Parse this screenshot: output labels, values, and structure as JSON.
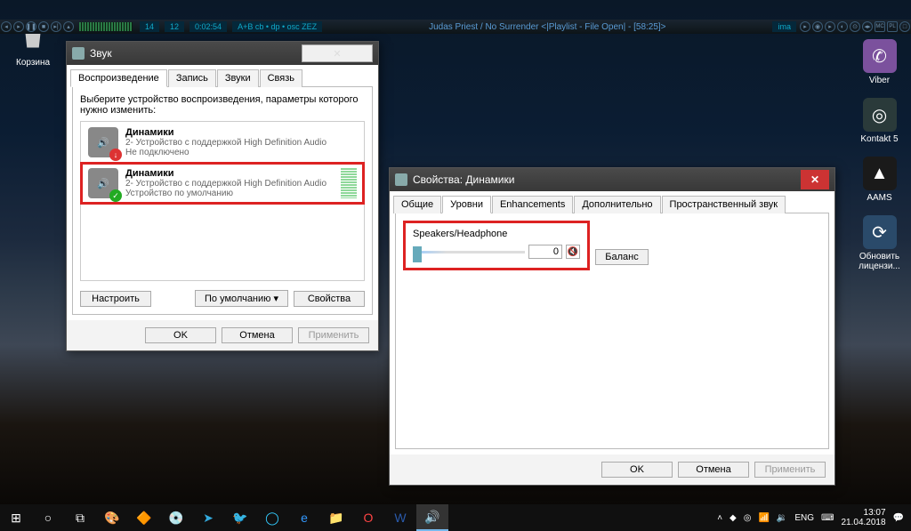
{
  "topbar": {
    "track_no": "14",
    "sub": "12",
    "time": "0:02:54",
    "codec": "A+B cb • dp • osc ZEZ",
    "now_playing": "Judas Priest / No Surrender   <|Playlist - File Open| - [58:25]>",
    "wma": "ima"
  },
  "trash_label": "Корзина",
  "desktop_icons": [
    {
      "label": "Viber",
      "bg": "#7b519d",
      "glyph": "✆"
    },
    {
      "label": "Kontakt 5",
      "bg": "#2a3a3a",
      "glyph": "◎"
    },
    {
      "label": "AAMS",
      "bg": "#1a1a1a",
      "glyph": "▲"
    },
    {
      "label": "Обновить лицензи...",
      "bg": "#2a4a6a",
      "glyph": "⟳"
    }
  ],
  "sound_win": {
    "title": "Звук",
    "tabs": [
      "Воспроизведение",
      "Запись",
      "Звуки",
      "Связь"
    ],
    "instruction": "Выберите устройство воспроизведения, параметры которого нужно изменить:",
    "devices": [
      {
        "name": "Динамики",
        "sub1": "2- Устройство с поддержкой High Definition Audio",
        "sub2": "Не подключено",
        "badge_color": "#d33",
        "badge_glyph": "↓",
        "highlight": false,
        "meter": false
      },
      {
        "name": "Динамики",
        "sub1": "2- Устройство с поддержкой High Definition Audio",
        "sub2": "Устройство по умолчанию",
        "badge_color": "#2a2",
        "badge_glyph": "✓",
        "highlight": true,
        "meter": true
      }
    ],
    "btn_configure": "Настроить",
    "btn_default": "По умолчанию",
    "btn_properties": "Свойства",
    "btn_ok": "OK",
    "btn_cancel": "Отмена",
    "btn_apply": "Применить"
  },
  "props_win": {
    "title": "Свойства: Динамики",
    "tabs": [
      "Общие",
      "Уровни",
      "Enhancements",
      "Дополнительно",
      "Пространственный звук"
    ],
    "level_label": "Speakers/Headphone",
    "level_value": "0",
    "btn_balance": "Баланс",
    "btn_ok": "OK",
    "btn_cancel": "Отмена",
    "btn_apply": "Применить"
  },
  "tray": {
    "lang": "ENG",
    "time": "13:07",
    "date": "21.04.2018"
  }
}
